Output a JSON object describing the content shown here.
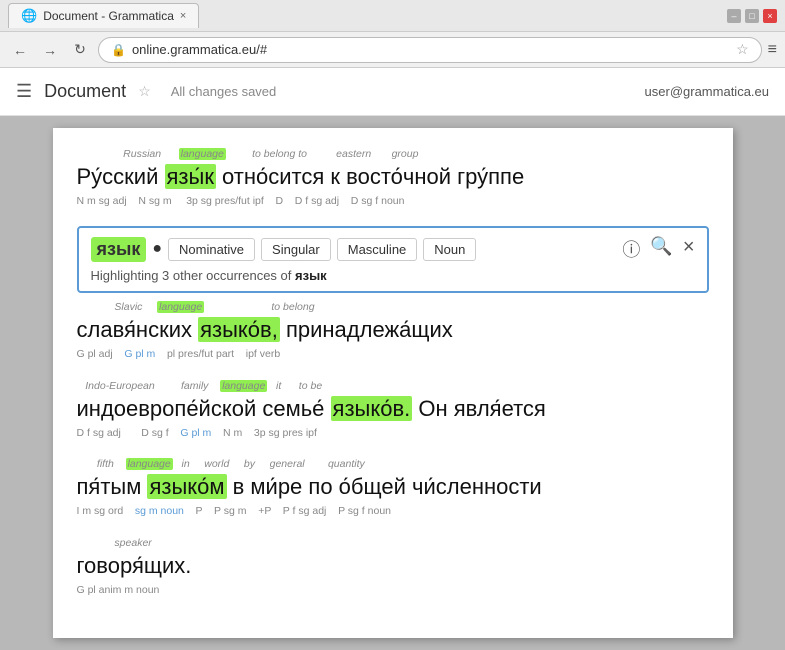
{
  "window": {
    "title": "Document - Grammatica",
    "tab_label": "Document - Grammatica",
    "close_x": "×"
  },
  "browser": {
    "url": "online.grammatica.eu/#",
    "back_icon": "←",
    "forward_icon": "→",
    "reload_icon": "↻",
    "menu_icon": "≡",
    "star_icon": "☆"
  },
  "app": {
    "menu_icon": "☰",
    "title": "Document",
    "star_icon": "☆",
    "saved_text": "All changes saved",
    "user_email": "user@grammatica.eu"
  },
  "popup": {
    "word": "язык",
    "dot": "●",
    "tags": [
      "Nominative",
      "Singular",
      "Masculine",
      "Noun"
    ],
    "info_icon": "ⓘ",
    "search_icon": "🔍",
    "close_icon": "×",
    "highlight_text": "Highlighting 3 other occurrences of",
    "highlight_word": "язык"
  },
  "sentences": [
    {
      "top_labels": "Russian   language   to belong to   eastern   group",
      "text_html": "Ру́сский язы́к отно́сится к восто́чной гру́ппе",
      "grammar_line": "N m sg adj   N sg m   3p sg pres/fut ipf   D   D f sg adj   D sg f noun",
      "words": [
        {
          "text": "Ру́сский",
          "ann": "Russian",
          "gram": "N m sg adj",
          "hl": ""
        },
        {
          "text": "язы́к",
          "ann": "language",
          "gram": "N sg m",
          "hl": ""
        },
        {
          "text": "отно́сится",
          "ann": "to belong to",
          "gram": "3p sg pres/fut ipf",
          "hl": ""
        },
        {
          "text": "к",
          "ann": "",
          "gram": "D",
          "hl": ""
        },
        {
          "text": "восто́чной",
          "ann": "eastern",
          "gram": "D f sg adj",
          "hl": ""
        },
        {
          "text": "гру́ппе",
          "ann": "group",
          "gram": "D sg f noun",
          "hl": ""
        }
      ]
    },
    {
      "top_labels": "Slavic   language   to belong",
      "text": "славя́нских языко́в, принадлежа́щих",
      "grammar_line": "G pl adj   G pl m   pl pres/fut part   ipf verb",
      "words": [
        {
          "text": "славя́нских",
          "ann": "Slavic",
          "gram": "G pl adj",
          "hl": ""
        },
        {
          "text": "языко́в,",
          "ann": "language",
          "gram": "G pl m",
          "hl": "green"
        },
        {
          "text": "принадлежа́щих",
          "ann": "to belong",
          "gram": "pl pres/fut part   ipf verb",
          "hl": ""
        }
      ]
    },
    {
      "top_labels": "Indo-European   family   language   it   to be",
      "text": "индоевропе́йской семье́ языко́в. Он явля́ется",
      "grammar_line": "D f sg adj   D sg f   G pl m   N m   3p sg pres ipf",
      "words": [
        {
          "text": "индоевропе́йской",
          "ann": "Indo-European",
          "gram": "D f sg adj",
          "hl": ""
        },
        {
          "text": "семье́",
          "ann": "family",
          "gram": "D sg f",
          "hl": ""
        },
        {
          "text": "языко́в.",
          "ann": "language",
          "gram": "G pl m",
          "hl": "green"
        },
        {
          "text": "Он",
          "ann": "it",
          "gram": "N m",
          "hl": ""
        },
        {
          "text": "явля́ется",
          "ann": "to be",
          "gram": "3p sg pres ipf",
          "hl": ""
        }
      ]
    },
    {
      "top_labels": "fifth   language   in   world   by   general   quantity",
      "text": "пя́тым языко́м в ми́ре по о́бщей чи́сленности",
      "grammar_line": "I m sg ord   sg m noun   P   P sg m   +P   P f sg adj   P sg f noun",
      "words": [
        {
          "text": "пя́тым",
          "ann": "fifth",
          "gram": "I m sg ord",
          "hl": ""
        },
        {
          "text": "языко́м",
          "ann": "language",
          "gram": "sg m noun",
          "hl": "green"
        },
        {
          "text": "в",
          "ann": "in",
          "gram": "P",
          "hl": ""
        },
        {
          "text": "ми́ре",
          "ann": "world",
          "gram": "P sg m",
          "hl": ""
        },
        {
          "text": "по",
          "ann": "by",
          "gram": "+P",
          "hl": ""
        },
        {
          "text": "о́бщей",
          "ann": "general",
          "gram": "P f sg adj",
          "hl": ""
        },
        {
          "text": "чи́сленности",
          "ann": "quantity",
          "gram": "P sg f noun",
          "hl": ""
        }
      ]
    },
    {
      "top_labels": "speaker",
      "text": "говоря́щих.",
      "grammar_line": "G pl anim m noun",
      "words": [
        {
          "text": "говоря́щих.",
          "ann": "speaker",
          "gram": "G pl anim m noun",
          "hl": ""
        }
      ]
    }
  ]
}
